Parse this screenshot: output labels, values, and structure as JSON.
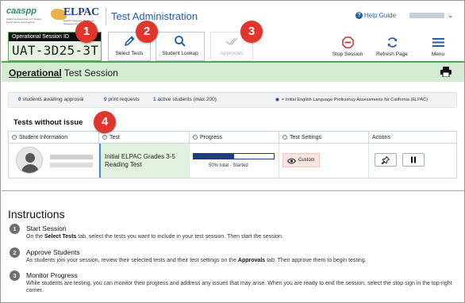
{
  "header": {
    "logo_caaspp_mark": "caaspp",
    "logo_caaspp_sub": "California Assessment of Student Performance and Progress",
    "logo_elpac": "ELPAC",
    "logo_elpac_sub": "English Language Proficiency Assessments for California",
    "app_title": "Test Administration",
    "help_label": "Help Guide",
    "help_icon": "question-circle-icon",
    "user_menu_icon": "chevron-down-icon"
  },
  "session": {
    "label": "Operational Session ID",
    "id": "UAT-3D25-3T"
  },
  "toolbar": {
    "select_tests": "Select Tests",
    "student_lookup": "Student Lookup",
    "approvals": "Approvals",
    "stop_session": "Stop Session",
    "refresh_page": "Refresh Page",
    "menu": "Menu"
  },
  "banner": {
    "title_bold": "Operational",
    "title_rest": " Test Session"
  },
  "stats": {
    "awaiting_count": "0",
    "awaiting_label": " students awaiting approval",
    "print_count": "0",
    "print_label": " print requests",
    "active_count": "1",
    "active_label": " active students (max 200)",
    "legend": "= Initial English Language Proficiency Assessments for California (ELPAC)"
  },
  "tests_section": {
    "title": "Tests without issue",
    "columns": [
      "Student Information",
      "Test",
      "Progress",
      "Test Settings",
      "Actions"
    ],
    "rows": [
      {
        "test": "Initial ELPAC Grades 3-5 Reading Test",
        "progress_percent": 50,
        "progress_text": "50% total  -  Started",
        "settings": "Custom"
      }
    ]
  },
  "instructions": {
    "title": "Instructions",
    "steps": [
      {
        "num": "1",
        "heading": "Start Session",
        "pre": "On the ",
        "bold": "Select Tests",
        "post": " tab, select the tests you want to include in your test session. Then start the session."
      },
      {
        "num": "2",
        "heading": "Approve Students",
        "pre": "As students join your session, review their selected tests and their test settings on the ",
        "bold": "Approvals",
        "post": " tab. Then approve them to begin testing."
      },
      {
        "num": "3",
        "heading": "Monitor Progress",
        "pre": "While students are testing, you can monitor their progress and address any issues that may arise. When you are ready to end the session, select the stop sign in the top-right corner.",
        "bold": "",
        "post": ""
      }
    ]
  },
  "markers": [
    "1",
    "2",
    "3",
    "4"
  ],
  "colors": {
    "brand_blue": "#1f5ea8",
    "session_green": "#d3ecd2",
    "marker_red": "#e0362d",
    "progress_navy": "#1f3f7a"
  }
}
